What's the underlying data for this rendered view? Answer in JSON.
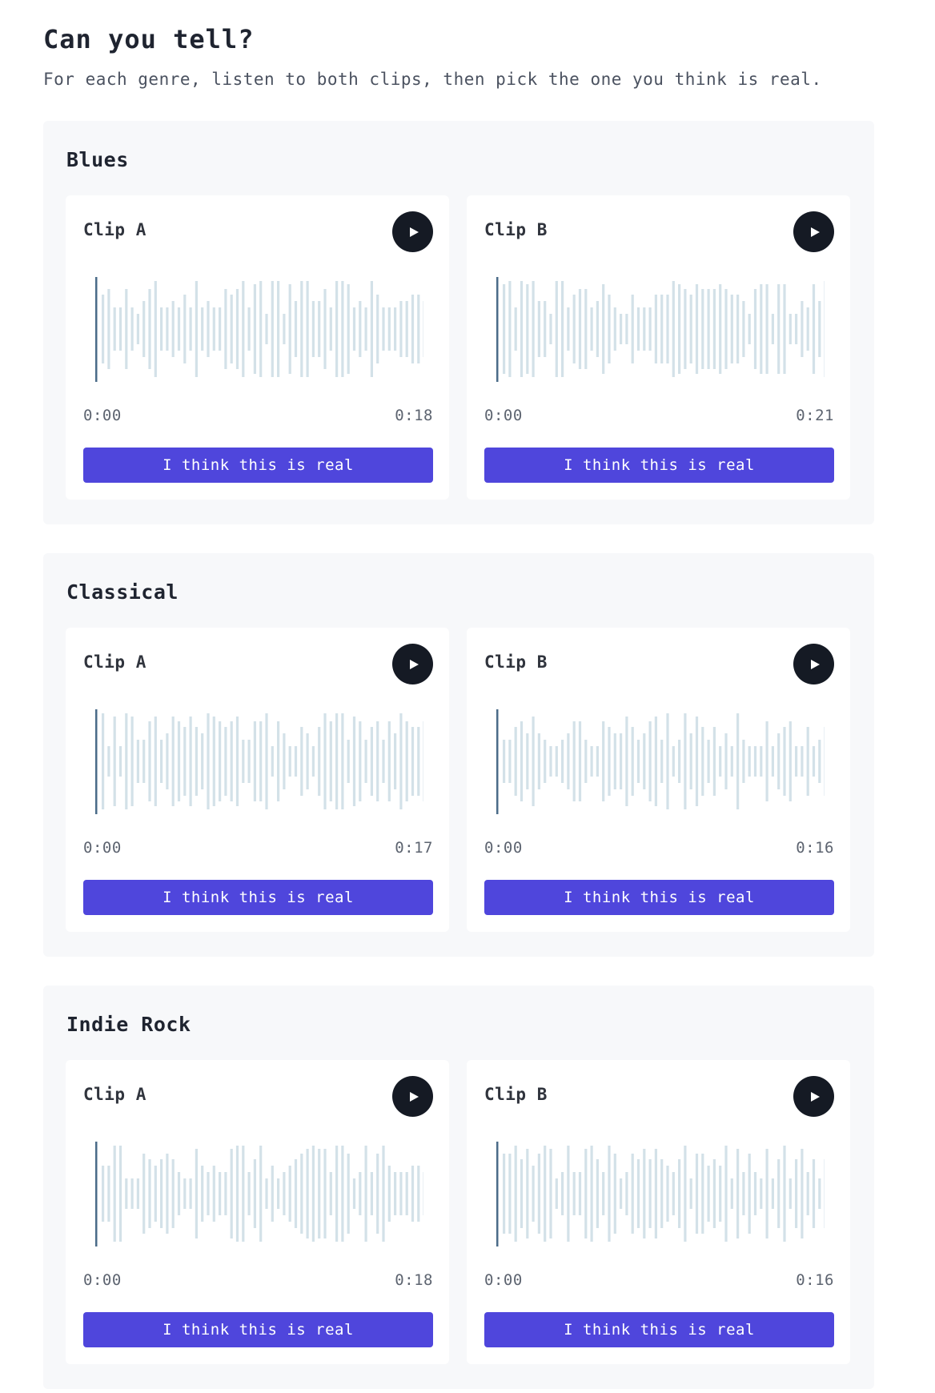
{
  "page": {
    "title": "Can you tell?",
    "subtitle": "For each genre, listen to both clips, then pick the one you think is real."
  },
  "colors": {
    "accent": "#4f46dc",
    "play_button": "#151a24",
    "waveform_bar": "#d3e1e8",
    "playhead": "#4a6b88"
  },
  "genres": [
    {
      "name": "Blues",
      "clips": [
        {
          "label": "Clip A",
          "current": "0:00",
          "duration": "0:18",
          "button_label": "I think this is real",
          "icon": "play-icon"
        },
        {
          "label": "Clip B",
          "current": "0:00",
          "duration": "0:21",
          "button_label": "I think this is real",
          "icon": "play-icon"
        }
      ]
    },
    {
      "name": "Classical",
      "clips": [
        {
          "label": "Clip A",
          "current": "0:00",
          "duration": "0:17",
          "button_label": "I think this is real",
          "icon": "play-icon"
        },
        {
          "label": "Clip B",
          "current": "0:00",
          "duration": "0:16",
          "button_label": "I think this is real",
          "icon": "play-icon"
        }
      ]
    },
    {
      "name": "Indie Rock",
      "clips": [
        {
          "label": "Clip A",
          "current": "0:00",
          "duration": "0:18",
          "button_label": "I think this is real",
          "icon": "play-icon"
        },
        {
          "label": "Clip B",
          "current": "0:00",
          "duration": "0:16",
          "button_label": "I think this is real",
          "icon": "play-icon"
        }
      ]
    }
  ]
}
